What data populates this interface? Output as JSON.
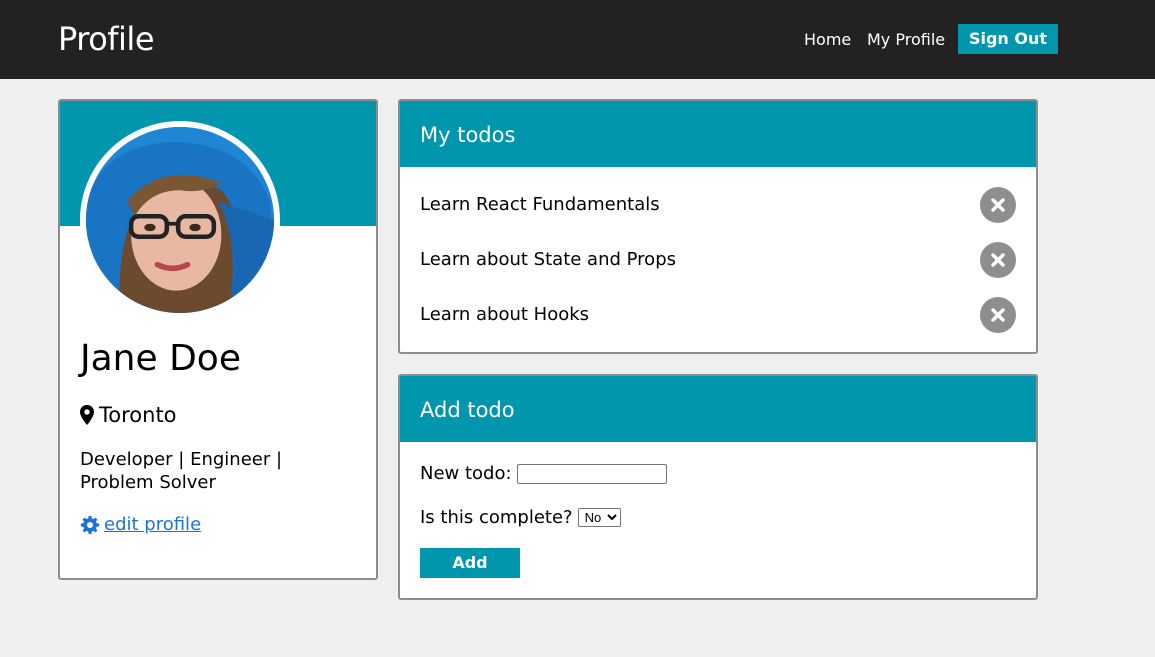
{
  "header": {
    "brand": "Profile",
    "nav": {
      "home": "Home",
      "my_profile": "My Profile",
      "sign_out": "Sign Out"
    }
  },
  "profile": {
    "name": "Jane Doe",
    "location": "Toronto",
    "location_icon": "map-marker-icon",
    "bio": "Developer | Engineer | Problem Solver",
    "edit_link": " edit profile",
    "edit_icon": "gear-icon"
  },
  "todos": {
    "title": "My todos",
    "items": [
      {
        "label": "Learn React Fundamentals"
      },
      {
        "label": "Learn about State and Props"
      },
      {
        "label": "Learn about Hooks"
      }
    ],
    "delete_icon": "close-circle-icon"
  },
  "add_todo": {
    "title": "Add todo",
    "new_todo_label": "New todo:",
    "new_todo_value": "",
    "complete_label": "Is this complete?",
    "complete_selected": "No",
    "add_button": "Add"
  },
  "colors": {
    "accent": "#0097ae",
    "topbar": "#222222",
    "link": "#1a73d9",
    "page_bg": "#f0f0f0",
    "delete_btn": "#8e8e8e"
  }
}
